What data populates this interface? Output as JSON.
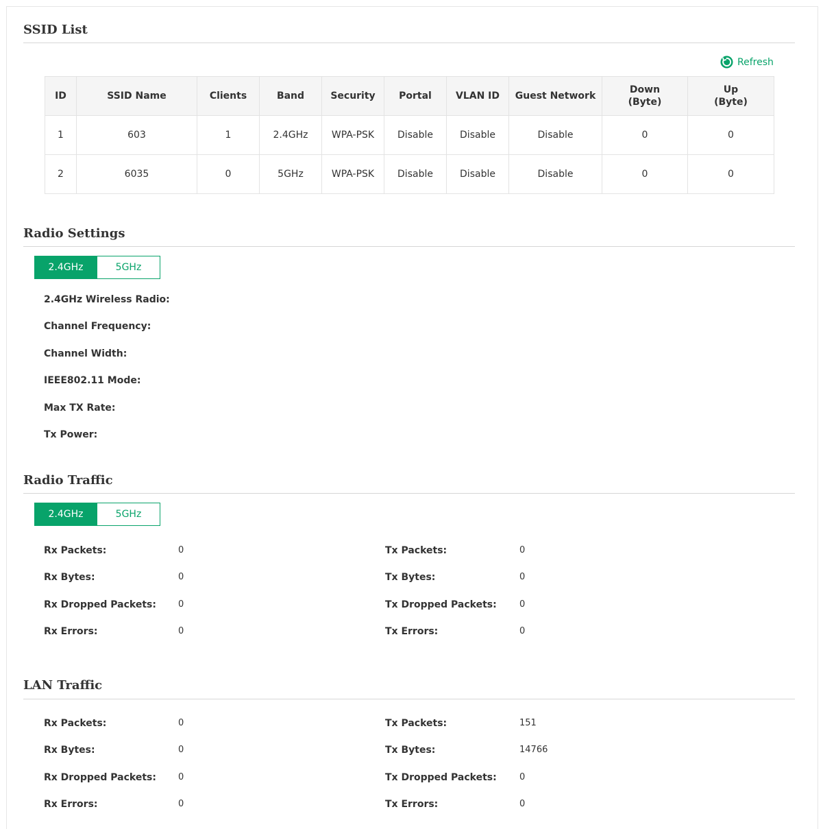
{
  "ssid_list": {
    "title": "SSID List",
    "refresh_label": "Refresh",
    "columns": [
      "ID",
      "SSID Name",
      "Clients",
      "Band",
      "Security",
      "Portal",
      "VLAN ID",
      "Guest Network",
      "Down\n(Byte)",
      "Up\n(Byte)"
    ],
    "rows": [
      [
        "1",
        "603",
        "1",
        "2.4GHz",
        "WPA-PSK",
        "Disable",
        "Disable",
        "Disable",
        "0",
        "0"
      ],
      [
        "2",
        "6035",
        "0",
        "5GHz",
        "WPA-PSK",
        "Disable",
        "Disable",
        "Disable",
        "0",
        "0"
      ]
    ]
  },
  "radio_settings": {
    "title": "Radio Settings",
    "tabs": [
      "2.4GHz",
      "5GHz"
    ],
    "active_tab": "2.4GHz",
    "fields": [
      "2.4GHz Wireless Radio:",
      "Channel Frequency:",
      "Channel Width:",
      "IEEE802.11 Mode:",
      "Max TX Rate:",
      "Tx Power:"
    ]
  },
  "radio_traffic": {
    "title": "Radio Traffic",
    "tabs": [
      "2.4GHz",
      "5GHz"
    ],
    "active_tab": "2.4GHz",
    "rx": [
      {
        "label": "Rx Packets:",
        "value": "0"
      },
      {
        "label": "Rx Bytes:",
        "value": "0"
      },
      {
        "label": "Rx Dropped Packets:",
        "value": "0"
      },
      {
        "label": "Rx Errors:",
        "value": "0"
      }
    ],
    "tx": [
      {
        "label": "Tx Packets:",
        "value": "0"
      },
      {
        "label": "Tx Bytes:",
        "value": "0"
      },
      {
        "label": "Tx Dropped Packets:",
        "value": "0"
      },
      {
        "label": "Tx Errors:",
        "value": "0"
      }
    ]
  },
  "lan_traffic": {
    "title": "LAN Traffic",
    "rx": [
      {
        "label": "Rx Packets:",
        "value": "0"
      },
      {
        "label": "Rx Bytes:",
        "value": "0"
      },
      {
        "label": "Rx Dropped Packets:",
        "value": "0"
      },
      {
        "label": "Rx Errors:",
        "value": "0"
      }
    ],
    "tx": [
      {
        "label": "Tx Packets:",
        "value": "151"
      },
      {
        "label": "Tx Bytes:",
        "value": "14766"
      },
      {
        "label": "Tx Dropped Packets:",
        "value": "0"
      },
      {
        "label": "Tx Errors:",
        "value": "0"
      }
    ]
  },
  "colors": {
    "accent": "#08a36a",
    "header_bg": "#f5f5f5"
  },
  "icons": {
    "refresh": "refresh-icon"
  }
}
